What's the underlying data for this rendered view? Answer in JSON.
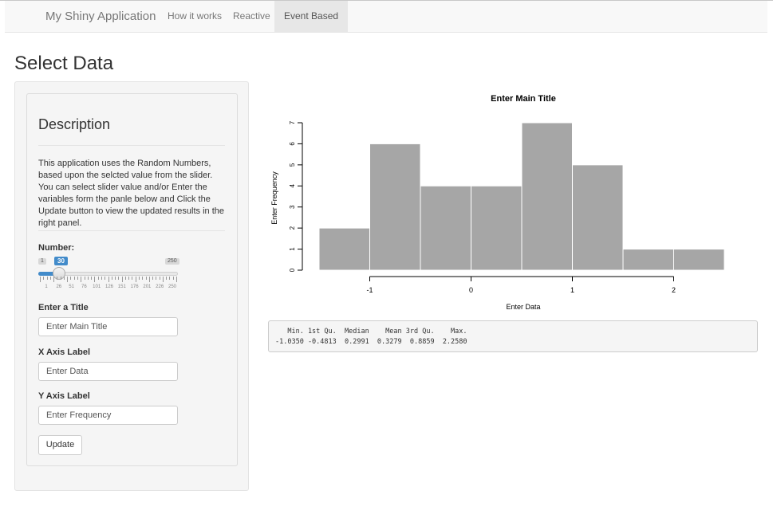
{
  "navbar": {
    "brand": "My Shiny Application",
    "links": [
      {
        "label": "How it works",
        "active": false
      },
      {
        "label": "Reactive",
        "active": false
      },
      {
        "label": "Event Based",
        "active": true
      }
    ]
  },
  "page_title": "Select Data",
  "sidebar": {
    "description_title": "Description",
    "description_text": "This application uses the Random Numbers, based upon the selcted value from the slider. You can select slider value and/or Enter the variables form the panle below and Click the Update button to view the updated results in the right panel.",
    "number_label": "Number:",
    "slider": {
      "min_label": "1",
      "max_label": "250",
      "value_label": "30",
      "value": 30,
      "min": 1,
      "max": 250,
      "tick_labels": [
        "1",
        "26",
        "51",
        "76",
        "101",
        "126",
        "151",
        "176",
        "201",
        "226",
        "250"
      ]
    },
    "title_label": "Enter a Title",
    "title_placeholder": "Enter Main Title",
    "xaxis_label": "X Axis Label",
    "xaxis_placeholder": "Enter Data",
    "yaxis_label": "Y Axis Label",
    "yaxis_placeholder": "Enter Frequency",
    "update_button": "Update"
  },
  "chart_data": {
    "type": "bar",
    "title": "Enter Main Title",
    "xlabel": "Enter Data",
    "ylabel": "Enter Frequency",
    "bins": [
      -1.5,
      -1.0,
      -0.5,
      0.0,
      0.5,
      1.0,
      1.5,
      2.0,
      2.5
    ],
    "values": [
      2,
      6,
      4,
      4,
      7,
      5,
      1,
      1
    ],
    "xticks": [
      -1,
      0,
      1,
      2
    ],
    "yticks": [
      0,
      1,
      2,
      3,
      4,
      5,
      6,
      7
    ],
    "bar_color": "#a6a6a6"
  },
  "summary": {
    "header": "   Min. 1st Qu.  Median    Mean 3rd Qu.    Max. ",
    "values": "-1.0350 -0.4813  0.2991  0.3279  0.8859  2.2580 "
  }
}
